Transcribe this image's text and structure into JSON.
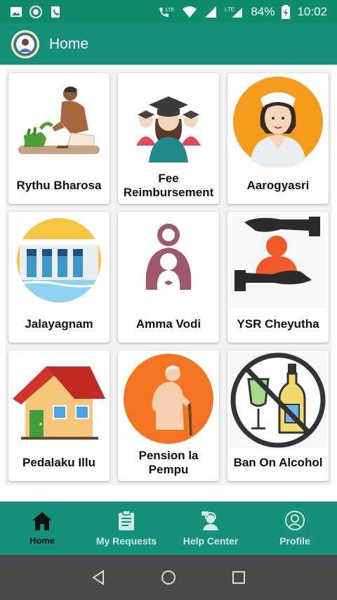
{
  "status_bar": {
    "battery": "84%",
    "time": "10:02",
    "lte1": "LTE",
    "lte2": "LTE"
  },
  "app_bar": {
    "title": "Home"
  },
  "cards": [
    {
      "label": "Rythu Bharosa",
      "icon": "farmer-icon"
    },
    {
      "label": "Fee Reimbursement",
      "icon": "graduates-icon"
    },
    {
      "label": "Aarogyasri",
      "icon": "nurse-icon"
    },
    {
      "label": "Jalayagnam",
      "icon": "dam-icon"
    },
    {
      "label": "Amma Vodi",
      "icon": "mother-child-icon"
    },
    {
      "label": "YSR Cheyutha",
      "icon": "helping-hands-icon"
    },
    {
      "label": "Pedalaku Illu",
      "icon": "house-icon"
    },
    {
      "label": "Pension la Pempu",
      "icon": "elderly-person-icon"
    },
    {
      "label": "Ban On Alcohol",
      "icon": "no-alcohol-icon"
    }
  ],
  "bottom_nav": {
    "items": [
      {
        "label": "Home",
        "icon": "home-icon",
        "active": true
      },
      {
        "label": "My Requests",
        "icon": "clipboard-icon"
      },
      {
        "label": "Help Center",
        "icon": "support-agent-icon"
      },
      {
        "label": "Profile",
        "icon": "profile-icon"
      }
    ]
  },
  "colors": {
    "primary": "#149178",
    "status_bar": "#0f8b6e",
    "system_nav": "#4a4a4a"
  }
}
